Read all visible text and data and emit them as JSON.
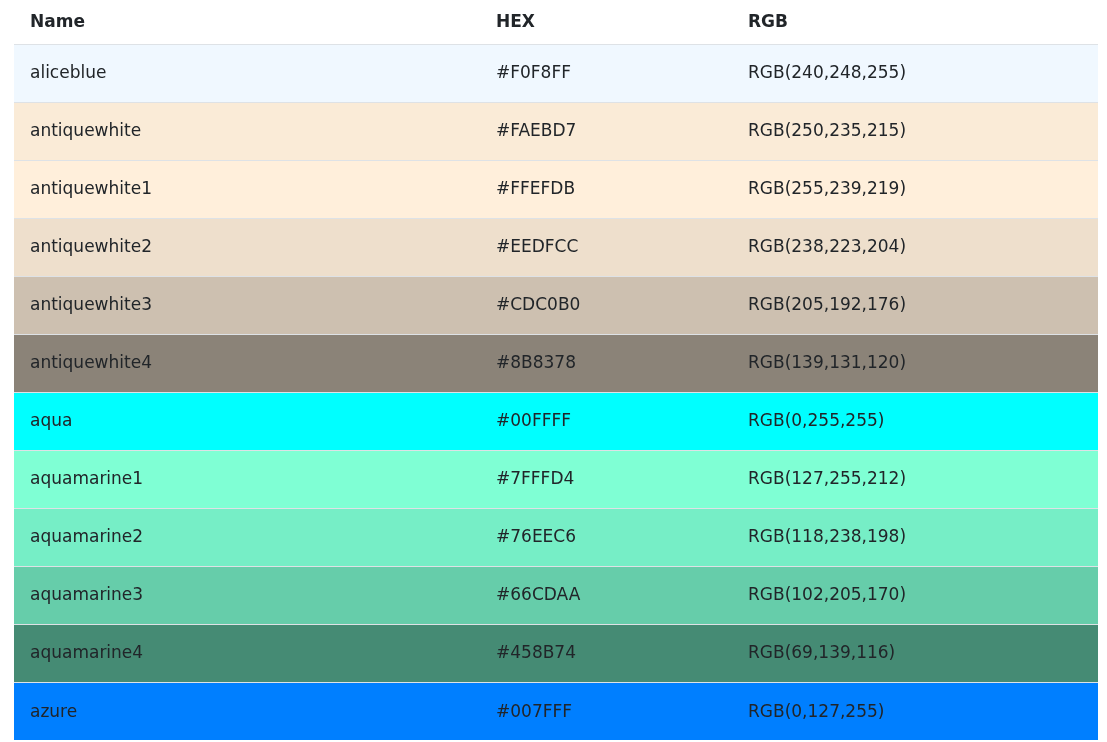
{
  "table": {
    "columns": [
      "Name",
      "HEX",
      "RGB"
    ],
    "rows": [
      {
        "name": "aliceblue",
        "hex": "#F0F8FF",
        "rgb": "RGB(240,248,255)",
        "color": "#f0f8ff"
      },
      {
        "name": "antiquewhite",
        "hex": "#FAEBD7",
        "rgb": "RGB(250,235,215)",
        "color": "#faebd7"
      },
      {
        "name": "antiquewhite1",
        "hex": "#FFEFDB",
        "rgb": "RGB(255,239,219)",
        "color": "#ffefdb"
      },
      {
        "name": "antiquewhite2",
        "hex": "#EEDFCC",
        "rgb": "RGB(238,223,204)",
        "color": "#eedfcc"
      },
      {
        "name": "antiquewhite3",
        "hex": "#CDC0B0",
        "rgb": "RGB(205,192,176)",
        "color": "#cdc0b0"
      },
      {
        "name": "antiquewhite4",
        "hex": "#8B8378",
        "rgb": "RGB(139,131,120)",
        "color": "#8b8378"
      },
      {
        "name": "aqua",
        "hex": "#00FFFF",
        "rgb": "RGB(0,255,255)",
        "color": "#00ffff"
      },
      {
        "name": "aquamarine1",
        "hex": "#7FFFD4",
        "rgb": "RGB(127,255,212)",
        "color": "#7fffd4"
      },
      {
        "name": "aquamarine2",
        "hex": "#76EEC6",
        "rgb": "RGB(118,238,198)",
        "color": "#76eec6"
      },
      {
        "name": "aquamarine3",
        "hex": "#66CDAA",
        "rgb": "RGB(102,205,170)",
        "color": "#66cdaa"
      },
      {
        "name": "aquamarine4",
        "hex": "#458B74",
        "rgb": "RGB(69,139,116)",
        "color": "#458b74"
      },
      {
        "name": "azure",
        "hex": "#007FFF",
        "rgb": "RGB(0,127,255)",
        "color": "#007fff"
      }
    ]
  }
}
